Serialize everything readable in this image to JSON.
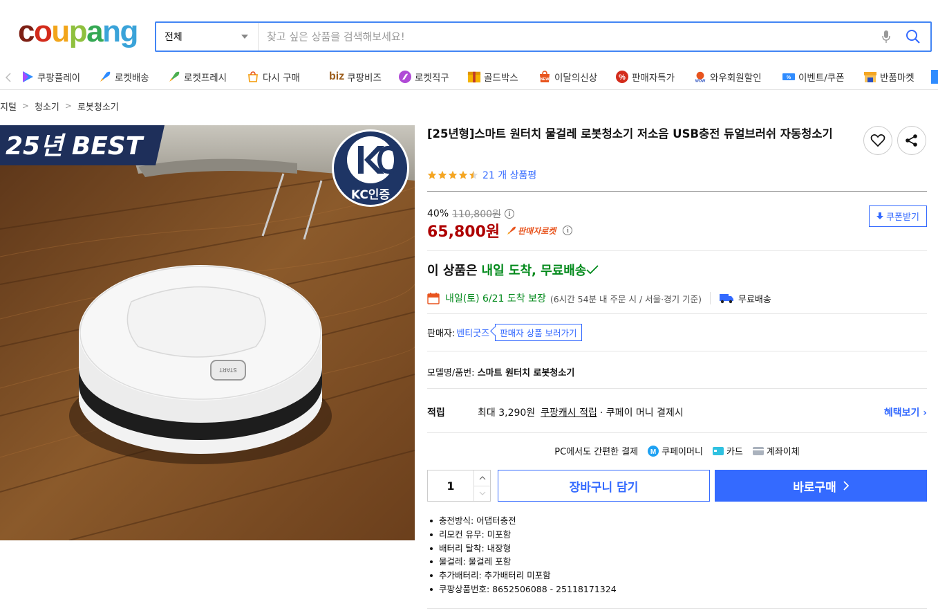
{
  "logo": {
    "text": "coupang"
  },
  "search": {
    "category": "전체",
    "placeholder": "찾고 싶은 상품을 검색해보세요!"
  },
  "nav": {
    "items": [
      {
        "label": "쿠팡플레이",
        "icon": "play-icon"
      },
      {
        "label": "로켓배송",
        "icon": "rocket-icon"
      },
      {
        "label": "로켓프레시",
        "icon": "rocket-fresh-icon"
      },
      {
        "label": "다시 구매",
        "icon": "rebuy-icon"
      },
      {
        "label": "쿠팡비즈",
        "prefix": "biz",
        "icon": "biz-icon"
      },
      {
        "label": "로켓직구",
        "icon": "global-icon"
      },
      {
        "label": "골드박스",
        "icon": "goldbox-icon"
      },
      {
        "label": "이달의신상",
        "icon": "new-icon"
      },
      {
        "label": "판매자특가",
        "icon": "percent-icon"
      },
      {
        "label": "와우회원할인",
        "icon": "wow-icon"
      },
      {
        "label": "이벤트/쿠폰",
        "icon": "coupon-icon"
      },
      {
        "label": "반품마켓",
        "icon": "return-market-icon"
      }
    ]
  },
  "breadcrumb": [
    "지털",
    "청소기",
    "로봇청소기"
  ],
  "image": {
    "banner": "25년 BEST",
    "kc": "KC인증",
    "button": "START"
  },
  "product": {
    "title": "[25년형]스마트 원터치 물걸레 로봇청소기 저소음 USB충전 듀얼브러쉬 자동청소기",
    "rating": 4.5,
    "review_count": "21 개 상품평",
    "discount": "40%",
    "original_price": "110,800원",
    "price": "65,800원",
    "badge": "판매자로켓",
    "coupon_label": "쿠폰받기"
  },
  "delivery": {
    "headline_prefix": "이 상품은",
    "headline_highlight": "내일 도착, 무료배송",
    "date": "내일(토) 6/21 도착 보장",
    "note": "(6시간 54분 내 주문 시 / 서울·경기 기준)",
    "shipping": "무료배송"
  },
  "seller": {
    "label": "판매자:",
    "name": "벤티굿즈",
    "link": "판매자 상품 보러가기"
  },
  "model": {
    "label": "모델명/품번:",
    "value": "스마트 원터치 로봇청소기"
  },
  "points": {
    "label": "적립",
    "max": "최대 3,290원",
    "cash": "쿠팡캐시 적립",
    "tail": "· 쿠페이 머니 결제시",
    "more": "혜택보기"
  },
  "payment": {
    "label": "PC에서도 간편한 결제",
    "methods": [
      "쿠페이머니",
      "카드",
      "계좌이체"
    ]
  },
  "purchase": {
    "quantity": "1",
    "cart_label": "장바구니 담기",
    "buy_label": "바로구매"
  },
  "specs": [
    "충전방식: 어댑터충전",
    "리모컨 유무: 미포함",
    "배터리 탈착: 내장형",
    "물걸레: 물걸레 포함",
    "추가배터리: 추가배터리 미포함",
    "쿠팡상품번호: 8652506088 - 25118171324"
  ],
  "colors": {
    "accent": "#346aff",
    "price": "#ae0000",
    "delivery": "#00891a",
    "star": "#f5a623"
  }
}
